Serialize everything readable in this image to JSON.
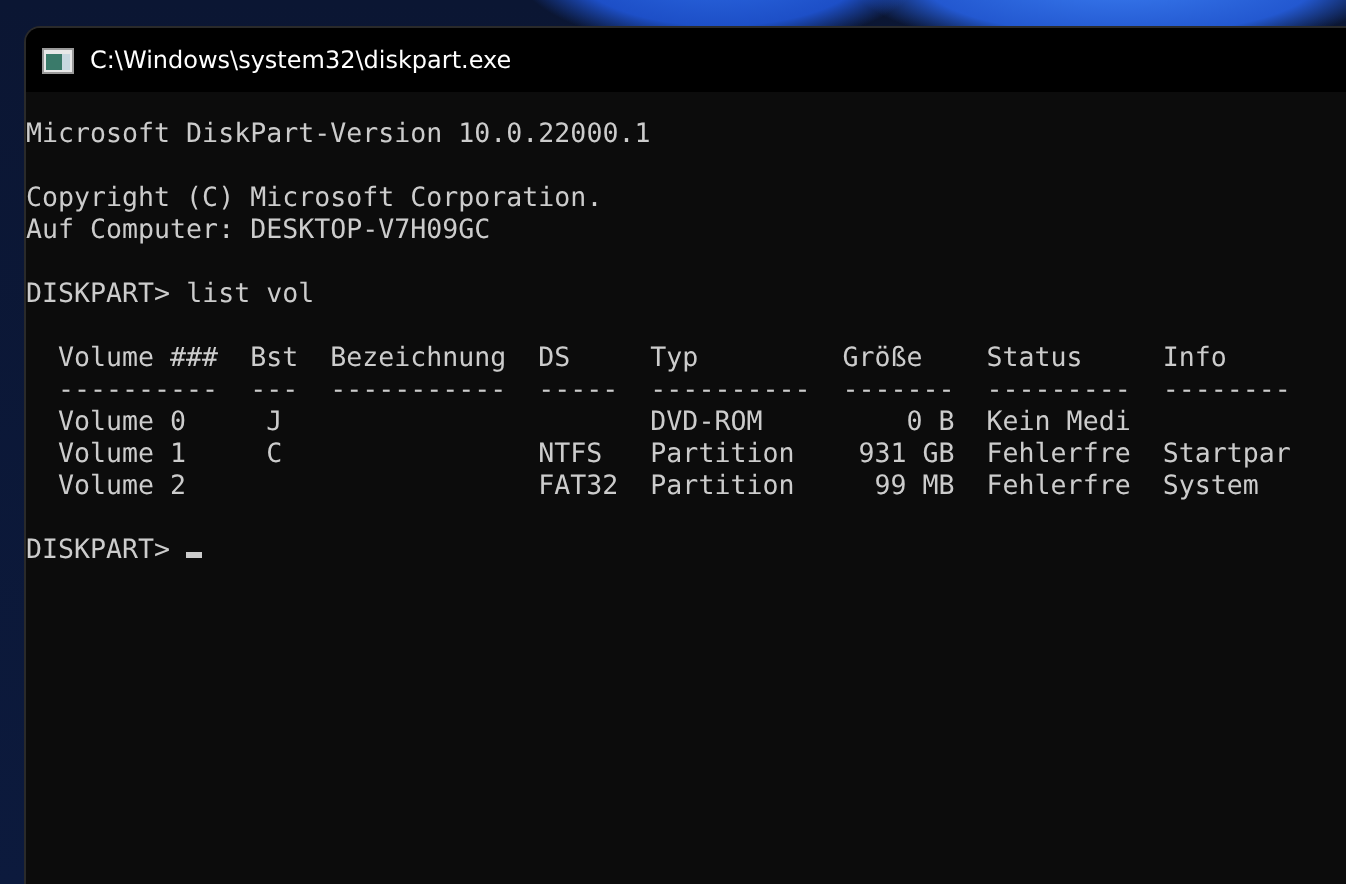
{
  "window": {
    "title": "C:\\Windows\\system32\\diskpart.exe"
  },
  "console": {
    "version_line": "Microsoft DiskPart-Version 10.0.22000.1",
    "info_lines": [
      "Copyright (C) Microsoft Corporation.",
      "Auf Computer: DESKTOP-V7H09GC"
    ],
    "command": {
      "prompt": "DISKPART>",
      "text": "list vol"
    },
    "table": {
      "columns": [
        {
          "label": "Volume ###",
          "rule": "----------"
        },
        {
          "label": "Bst",
          "rule": "---"
        },
        {
          "label": "Bezeichnung",
          "rule": "-----------"
        },
        {
          "label": "DS",
          "rule": "-----"
        },
        {
          "label": "Typ",
          "rule": "----------"
        },
        {
          "label": "Größe",
          "rule": "-------"
        },
        {
          "label": "Status",
          "rule": "---------"
        },
        {
          "label": "Info",
          "rule": "--------"
        }
      ],
      "rows": [
        [
          "Volume 0",
          "J",
          null,
          null,
          "DVD-ROM",
          "0 B",
          "Kein Medi",
          null
        ],
        [
          "Volume 1",
          "C",
          null,
          "NTFS",
          "Partition",
          "931 GB",
          "Fehlerfre",
          "Startpar"
        ],
        [
          "Volume 2",
          null,
          null,
          "FAT32",
          "Partition",
          "99 MB",
          "Fehlerfre",
          "System"
        ]
      ]
    },
    "final_prompt": "DISKPART>"
  }
}
